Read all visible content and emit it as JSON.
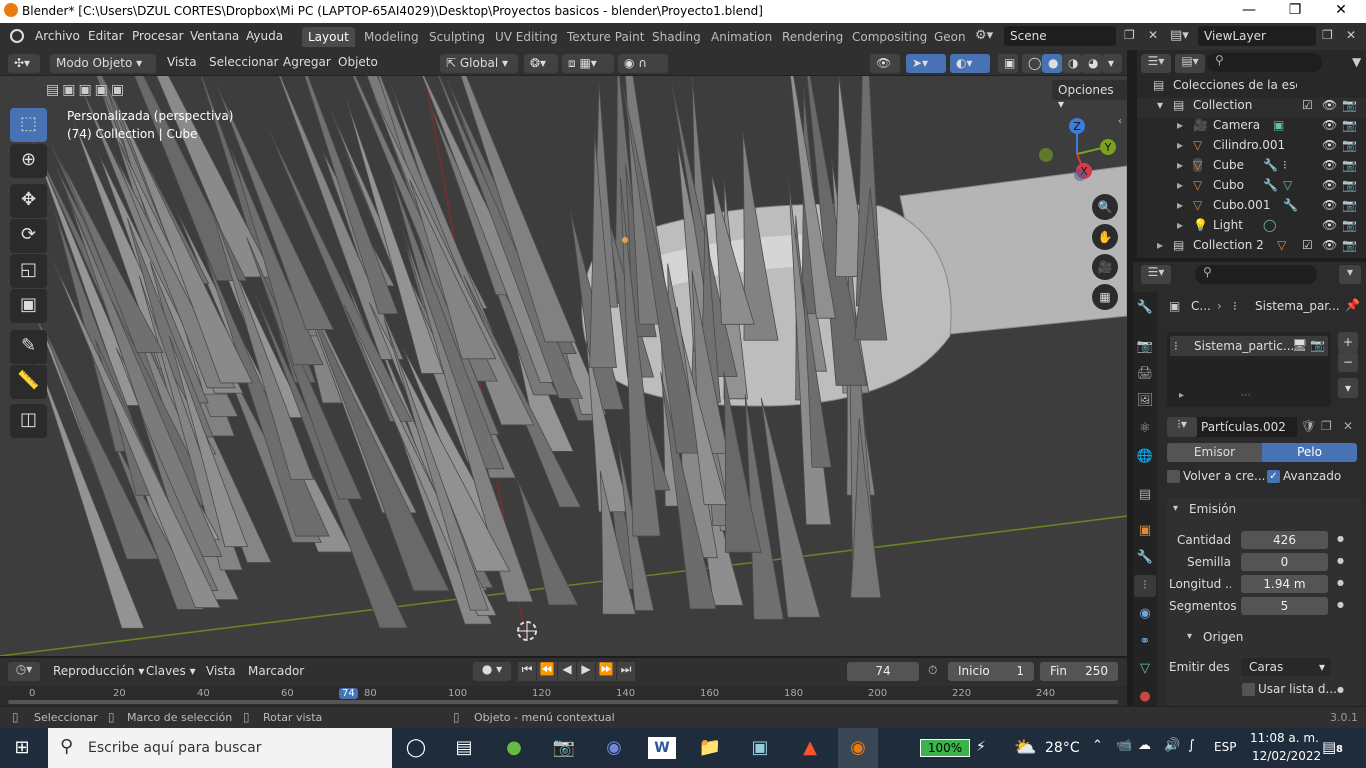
{
  "window": {
    "title": "Blender* [C:\\Users\\DZUL CORTES\\Dropbox\\Mi PC (LAPTOP-65AI4029)\\Desktop\\Proyectos basicos - blender\\Proyecto1.blend]"
  },
  "menus": [
    "Archivo",
    "Editar",
    "Procesar",
    "Ventana",
    "Ayuda"
  ],
  "workspaces": [
    "Layout",
    "Modeling",
    "Sculpting",
    "UV Editing",
    "Texture Paint",
    "Shading",
    "Animation",
    "Rendering",
    "Compositing",
    "Geon"
  ],
  "scene": "Scene",
  "viewlayer": "ViewLayer",
  "viewport_header": {
    "mode": "Modo Objeto",
    "menus": [
      "Vista",
      "Seleccionar",
      "Agregar",
      "Objeto"
    ],
    "orientation": "Global",
    "options": "Opciones"
  },
  "viewport": {
    "overlay_line1": "Personalizada (perspectiva)",
    "overlay_line2": "(74) Collection | Cube"
  },
  "gizmo": {
    "x": "X",
    "y": "Y",
    "z": "Z"
  },
  "outliner": {
    "scene_collection": "Colecciones de la escena",
    "collection": "Collection",
    "items": [
      "Camera",
      "Cilindro.001",
      "Cube",
      "Cubo",
      "Cubo.001",
      "Light"
    ],
    "collection2": "Collection 2"
  },
  "properties": {
    "breadcrumb_obj": "C...",
    "breadcrumb_ps": "Sistema_par...",
    "list_item": "Sistema_partic...",
    "settings": "Partículas.002",
    "tab_emitter": "Emisor",
    "tab_hair": "Pelo",
    "regrow": "Volver a cre...",
    "advanced": "Avanzado",
    "panel_emission": "Emisión",
    "rows": [
      {
        "label": "Cantidad",
        "value": "426"
      },
      {
        "label": "Semilla",
        "value": "0"
      },
      {
        "label": "Longitud ...",
        "value": "1.94 m"
      },
      {
        "label": "Segmentos",
        "value": "5"
      }
    ],
    "panel_source": "Origen",
    "emit_from_label": "Emitir des...",
    "emit_from_value": "Caras",
    "modifier_stack": "Usar lista d..."
  },
  "timeline": {
    "playback": "Reproducción",
    "keying": "Claves",
    "view": "Vista",
    "marker": "Marcador",
    "current_frame": "74",
    "start_label": "Inicio",
    "start": "1",
    "end_label": "Fin",
    "end": "250",
    "ruler": [
      "0",
      "20",
      "40",
      "60",
      "74",
      "80",
      "100",
      "120",
      "140",
      "160",
      "180",
      "200",
      "220",
      "240"
    ]
  },
  "statusbar": {
    "select": "Seleccionar",
    "box_select": "Marco de selección",
    "rotate": "Rotar vista",
    "context": "Objeto - menú contextual",
    "version": "3.0.1"
  },
  "taskbar": {
    "search_placeholder": "Escribe aquí para buscar",
    "battery": "100%",
    "temperature": "28°C",
    "lang": "ESP",
    "time": "11:08 a. m.",
    "date": "12/02/2022",
    "notifications": "8"
  },
  "colors": {
    "accent": "#4772b3",
    "header": "#303030",
    "viewport": "#3d3d3d",
    "taskbar": "#1f2c3c"
  }
}
